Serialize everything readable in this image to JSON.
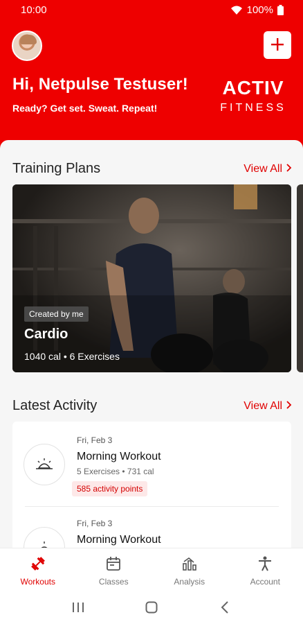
{
  "status": {
    "time": "10:00",
    "battery": "100%"
  },
  "header": {
    "greeting": "Hi, Netpulse Testuser!",
    "tagline": "Ready? Get set. Sweat. Repeat!",
    "brand_line1": "ACTIV",
    "brand_line2": "FITNESS",
    "add_icon": "plus-icon"
  },
  "training": {
    "title": "Training Plans",
    "view_all": "View All",
    "plan": {
      "badge": "Created by me",
      "name": "Cardio",
      "meta": "1040 cal • 6 Exercises"
    }
  },
  "activity": {
    "title": "Latest Activity",
    "view_all": "View All",
    "items": [
      {
        "date": "Fri, Feb 3",
        "title": "Morning Workout",
        "meta": "5 Exercises • 731 cal",
        "points": "585 activity points",
        "icon": "sunrise-icon"
      },
      {
        "date": "Fri, Feb 3",
        "title": "Morning Workout",
        "icon": "sunrise-icon"
      }
    ]
  },
  "nav": [
    {
      "label": "Workouts",
      "icon": "dumbbell-icon",
      "active": true
    },
    {
      "label": "Classes",
      "icon": "calendar-icon",
      "active": false
    },
    {
      "label": "Analysis",
      "icon": "chart-icon",
      "active": false
    },
    {
      "label": "Account",
      "icon": "person-icon",
      "active": false
    }
  ],
  "colors": {
    "brand": "#ee0000",
    "accent": "#e00000",
    "points_bg": "#fde8e8"
  }
}
